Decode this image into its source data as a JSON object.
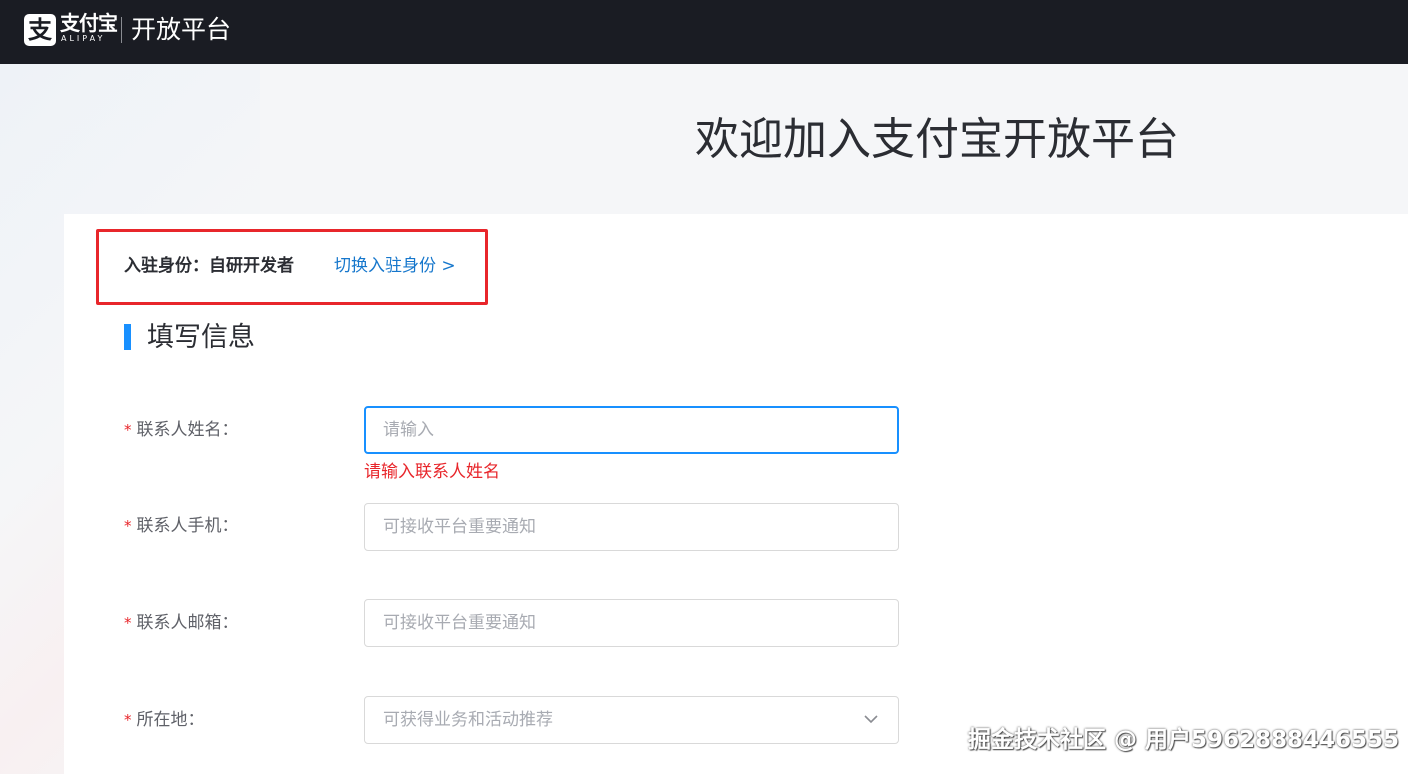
{
  "header": {
    "logo_glyph": "支",
    "brand_name": "支付宝",
    "brand_en": "ALIPAY",
    "platform_name": "开放平台"
  },
  "main": {
    "welcome_title": "欢迎加入支付宝开放平台",
    "identity": {
      "label": "入驻身份：自研开发者",
      "switch_label": "切换入驻身份 >"
    },
    "section_title": "填写信息",
    "fields": [
      {
        "label": "联系人姓名：",
        "required_mark": "*",
        "placeholder": "请输入",
        "value": "",
        "error": "请输入联系人姓名"
      },
      {
        "label": "联系人手机：",
        "required_mark": "*",
        "placeholder": "可接收平台重要通知",
        "value": ""
      },
      {
        "label": "联系人邮箱：",
        "required_mark": "*",
        "placeholder": "可接收平台重要通知",
        "value": ""
      },
      {
        "label": "所在地：",
        "required_mark": "*",
        "placeholder": "可获得业务和活动推荐",
        "icon": "chevron-down-icon"
      }
    ]
  },
  "watermark": "掘金技术社区 @ 用户5962888446555",
  "colors": {
    "topbar": "#1a1c23",
    "accent": "#1890ff",
    "link": "#1677cc",
    "error": "#e8262b"
  }
}
